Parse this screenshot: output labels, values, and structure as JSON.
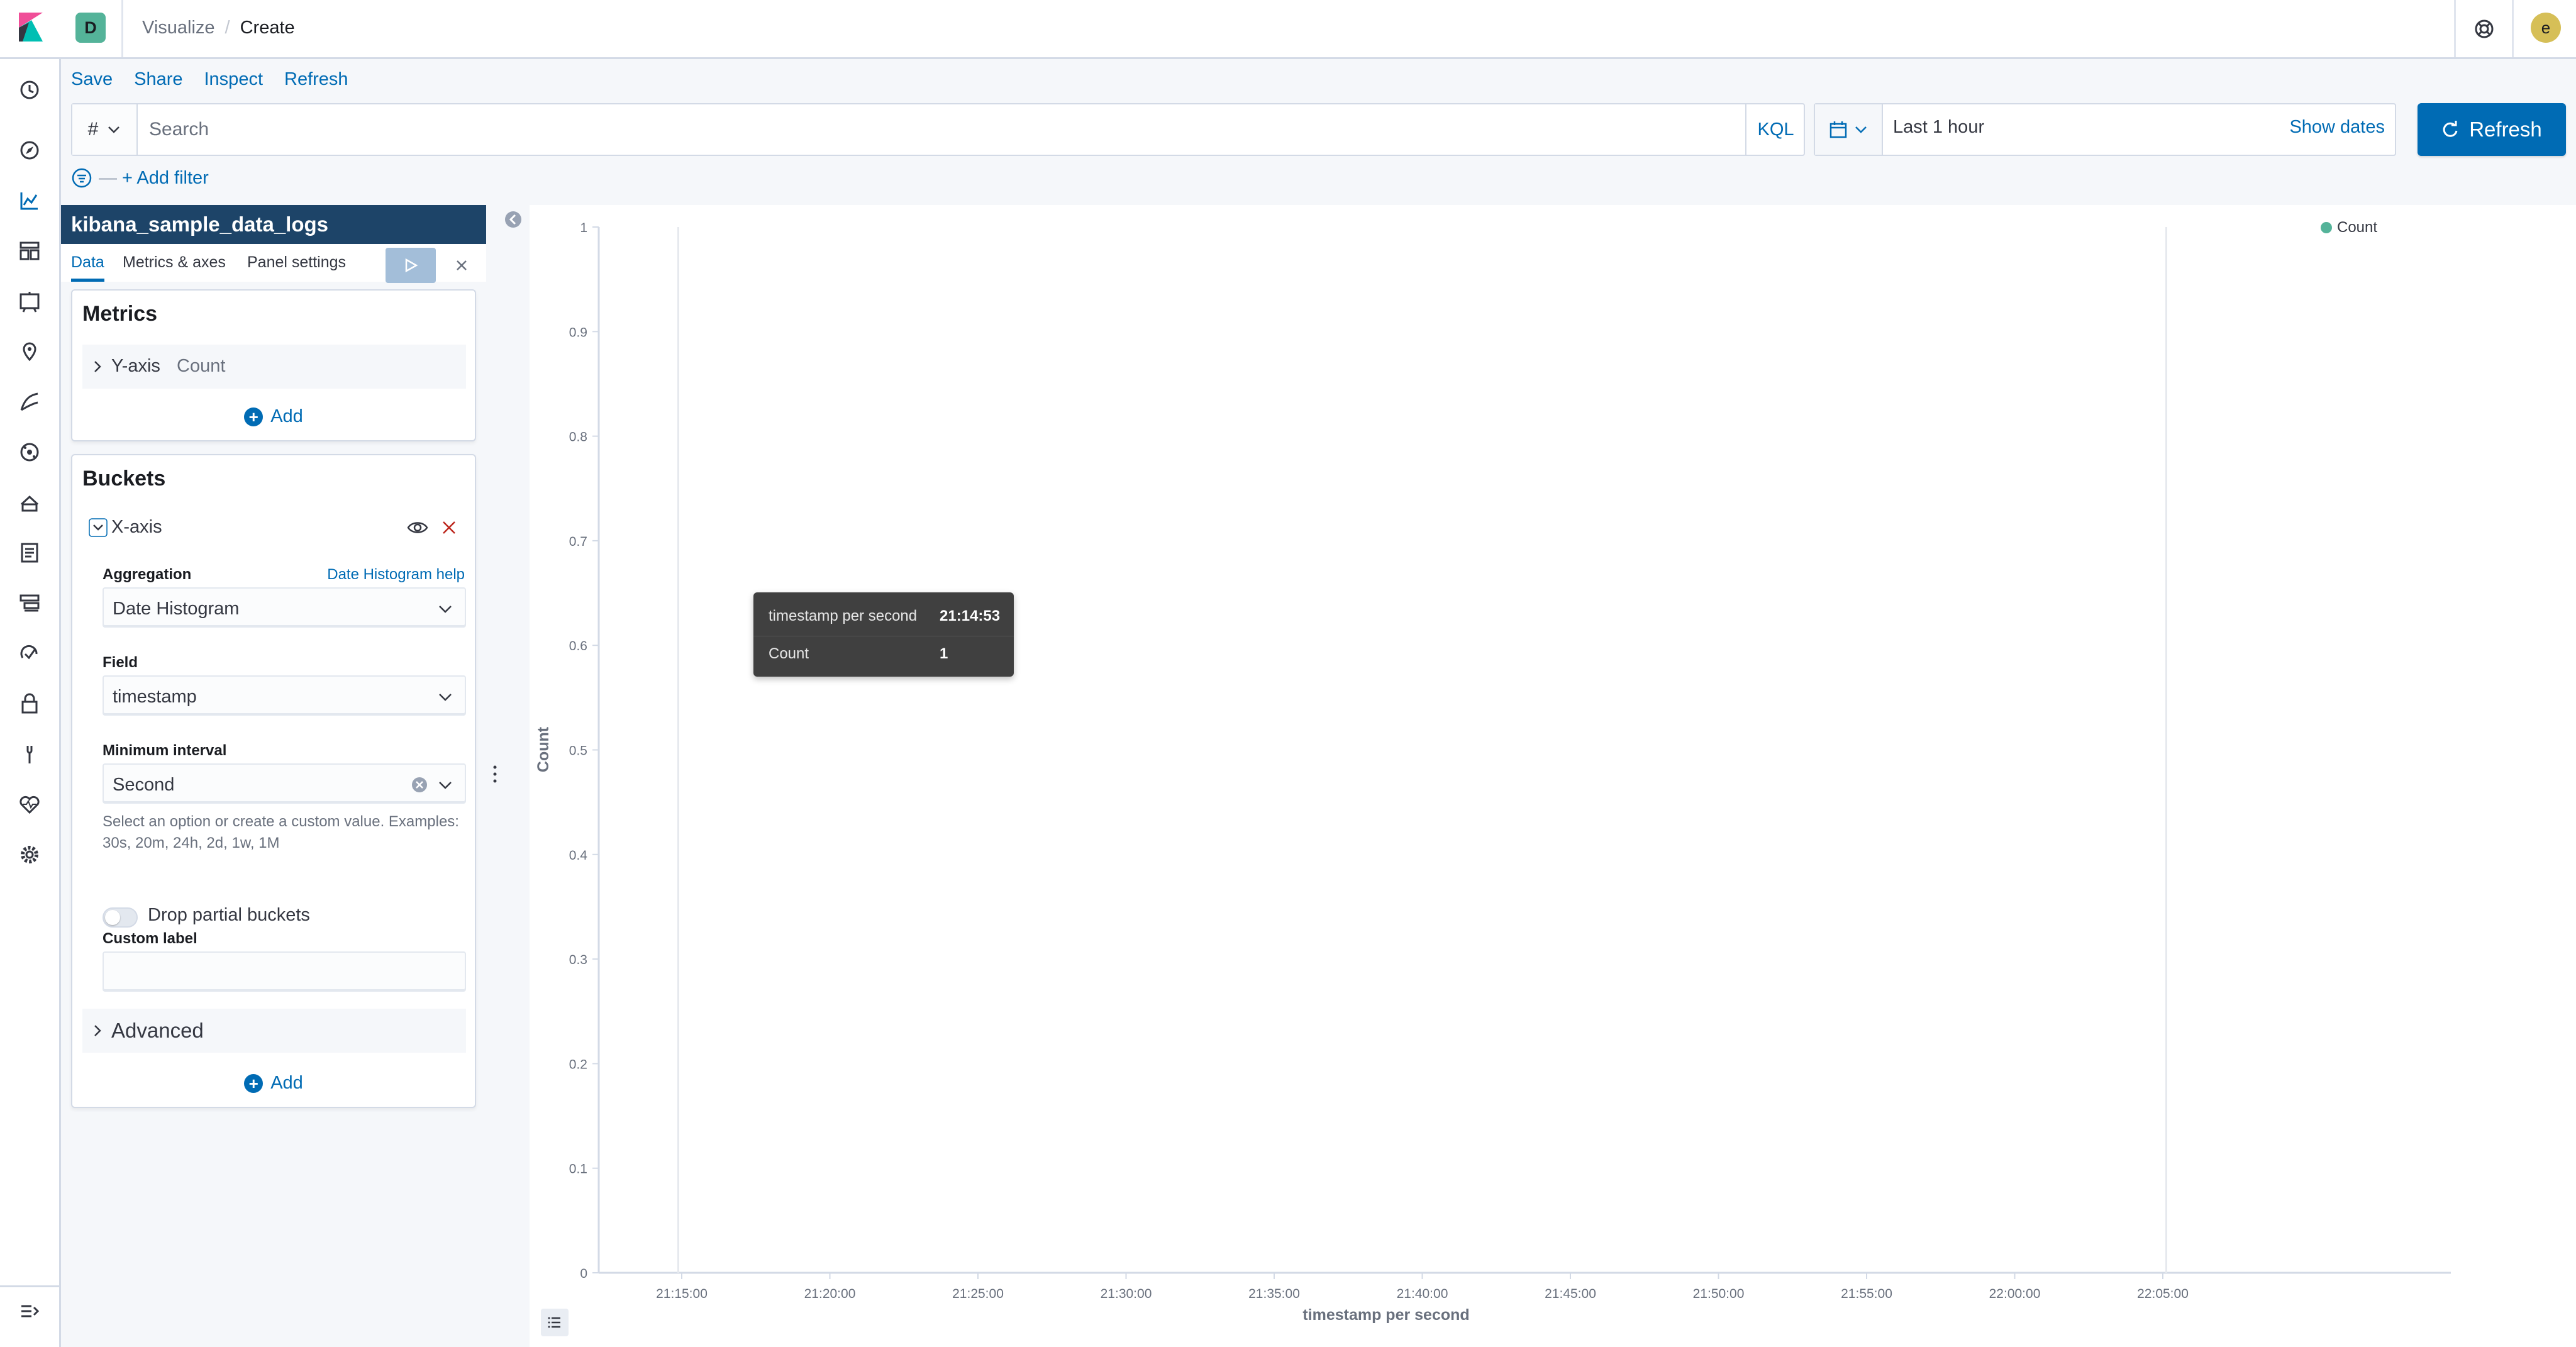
{
  "header": {
    "space_initial": "D",
    "breadcrumbs": [
      "Visualize",
      "Create"
    ],
    "avatar_initial": "e"
  },
  "top_menu": [
    "Save",
    "Share",
    "Inspect",
    "Refresh"
  ],
  "querybar": {
    "field_type_symbol": "#",
    "search_placeholder": "Search",
    "language": "KQL"
  },
  "datepicker": {
    "range": "Last 1 hour",
    "show_dates": "Show dates",
    "refresh_label": "Refresh"
  },
  "filterbar": {
    "add_filter": "+ Add filter"
  },
  "editor": {
    "index_pattern": "kibana_sample_data_logs",
    "tabs": [
      "Data",
      "Metrics & axes",
      "Panel settings"
    ],
    "active_tab": "Data",
    "metrics": {
      "title": "Metrics",
      "agg_name": "Y-axis",
      "agg_type": "Count",
      "add_label": "Add"
    },
    "buckets": {
      "title": "Buckets",
      "agg_name": "X-axis",
      "aggregation_label": "Aggregation",
      "aggregation_help": "Date Histogram help",
      "aggregation_value": "Date Histogram",
      "field_label": "Field",
      "field_value": "timestamp",
      "interval_label": "Minimum interval",
      "interval_value": "Second",
      "interval_help": "Select an option or create a custom value. Examples: 30s, 20m, 24h, 2d, 1w, 1M",
      "drop_partial_label": "Drop partial buckets",
      "drop_partial_enabled": false,
      "custom_label_label": "Custom label",
      "custom_label_value": "",
      "advanced_label": "Advanced",
      "add_label": "Add"
    }
  },
  "tooltip": {
    "rows": [
      {
        "label": "timestamp per second",
        "value": "21:14:53"
      },
      {
        "label": "Count",
        "value": "1"
      }
    ]
  },
  "colors": {
    "primary": "#006bb4",
    "index_header": "#1d4468",
    "series": "#54b399"
  },
  "chart_data": {
    "type": "bar",
    "xlabel": "timestamp per second",
    "ylabel": "Count",
    "ylim": [
      0,
      1
    ],
    "yticks": [
      "0",
      "0.1",
      "0.2",
      "0.3",
      "0.4",
      "0.5",
      "0.6",
      "0.7",
      "0.8",
      "0.9",
      "1"
    ],
    "xticks": [
      "21:15:00",
      "21:20:00",
      "21:25:00",
      "21:30:00",
      "21:35:00",
      "21:40:00",
      "21:45:00",
      "21:50:00",
      "21:55:00",
      "22:00:00",
      "22:05:00"
    ],
    "series": [
      {
        "name": "Count",
        "points": [
          {
            "x": "21:14:53",
            "y": 1
          },
          {
            "x": "22:05:07",
            "y": 1
          }
        ]
      }
    ],
    "legend": {
      "position": "top-right",
      "entries": [
        "Count"
      ]
    },
    "grid": false
  }
}
